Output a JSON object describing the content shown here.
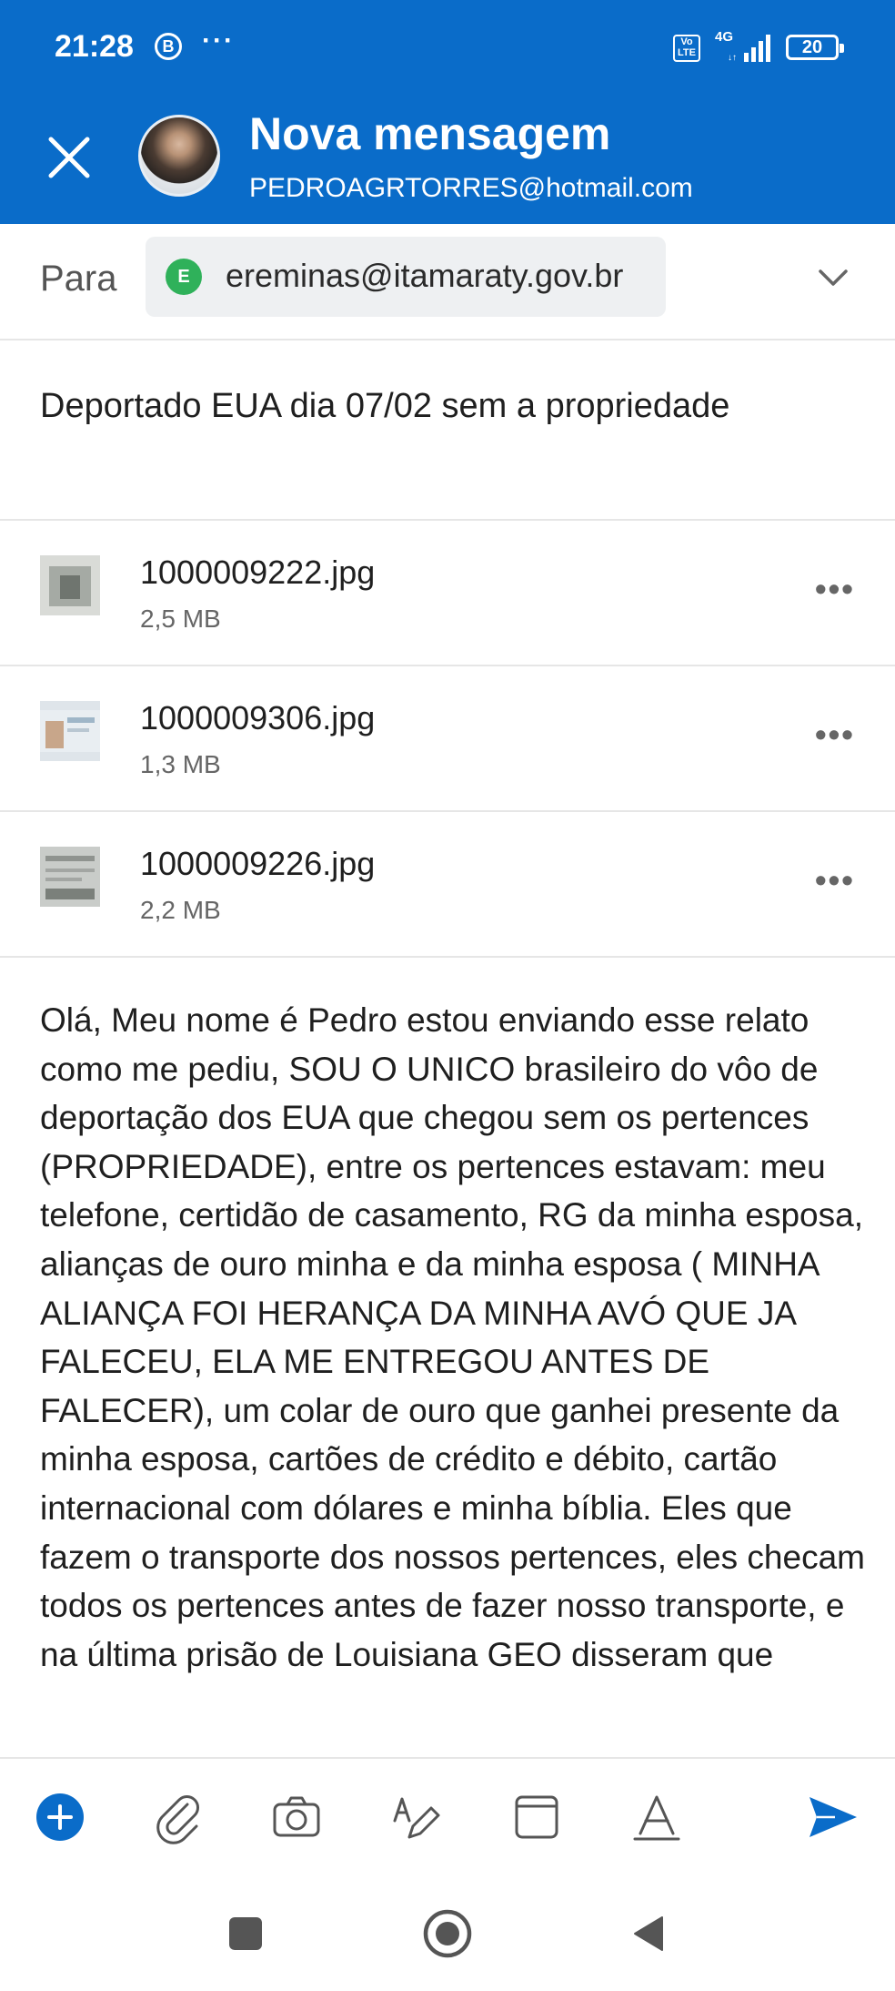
{
  "status_bar": {
    "time": "21:28",
    "badge": "B",
    "more": "···",
    "volte": "Vo LTE",
    "network": "4G",
    "battery": "20"
  },
  "header": {
    "title": "Nova mensagem",
    "from_email": "PEDROAGRTORRES@hotmail.com"
  },
  "to_row": {
    "label": "Para",
    "recipient_initial": "E",
    "recipient_email": "ereminas@itamaraty.gov.br"
  },
  "subject": "Deportado EUA dia 07/02 sem a propriedade",
  "attachments": [
    {
      "name": "1000009222.jpg",
      "size": "2,5 MB"
    },
    {
      "name": "1000009306.jpg",
      "size": "1,3 MB"
    },
    {
      "name": "1000009226.jpg",
      "size": "2,2 MB"
    }
  ],
  "body_text": "Olá, Meu nome é Pedro estou enviando esse relato como me pediu, SOU O UNICO brasileiro do vôo de deportação dos EUA que chegou sem os pertences (PROPRIEDADE), entre os pertences estavam: meu telefone, certidão de casamento, RG da minha esposa, alianças de ouro minha e da minha esposa ( MINHA ALIANÇA FOI HERANÇA DA MINHA AVÓ QUE JA FALECEU, ELA ME ENTREGOU ANTES DE FALECER), um colar de ouro que ganhei presente da minha esposa, cartões de crédito e débito, cartão internacional com dólares e minha bíblia. Eles que fazem o transporte dos nossos pertences, eles checam todos os pertences antes de fazer nosso transporte, e na última prisão de Louisiana GEO disseram que",
  "colors": {
    "accent": "#0a6cc9",
    "chip_bg": "#eef0f2",
    "recipient_avatar": "#2fb15a"
  },
  "icons": {
    "close": "close-icon",
    "add": "add-icon",
    "attach": "paperclip-icon",
    "camera": "camera-icon",
    "draw": "pen-draw-icon",
    "window": "window-icon",
    "format": "text-format-icon",
    "send": "send-icon"
  }
}
